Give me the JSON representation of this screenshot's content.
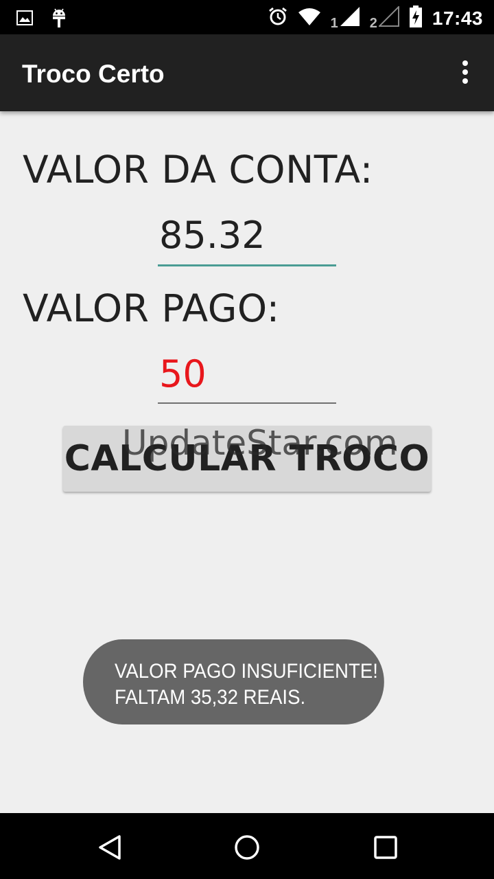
{
  "status_bar": {
    "icons_left": [
      "image-icon",
      "android-icon"
    ],
    "icons_right": [
      "alarm-icon",
      "wifi-icon",
      "signal-icon",
      "signal-icon",
      "battery-charging-icon"
    ],
    "sim1": "1",
    "sim2": "2",
    "time": "17:43"
  },
  "app_bar": {
    "title": "Troco Certo"
  },
  "form": {
    "conta_label": "VALOR DA CONTA:",
    "conta_value": "85.32",
    "pago_label": "VALOR PAGO:",
    "pago_value": "50",
    "pago_value_color": "#e8171c",
    "accent_color": "#4a9c94"
  },
  "button": {
    "label": "CALCULAR TROCO"
  },
  "watermark": "UpdateStar.com",
  "toast": {
    "line1": "VALOR PAGO INSUFICIENTE!",
    "line2": "FALTAM 35,32 REAIS."
  },
  "nav_bar": {
    "icons": [
      "back-icon",
      "home-icon",
      "recents-icon"
    ]
  }
}
